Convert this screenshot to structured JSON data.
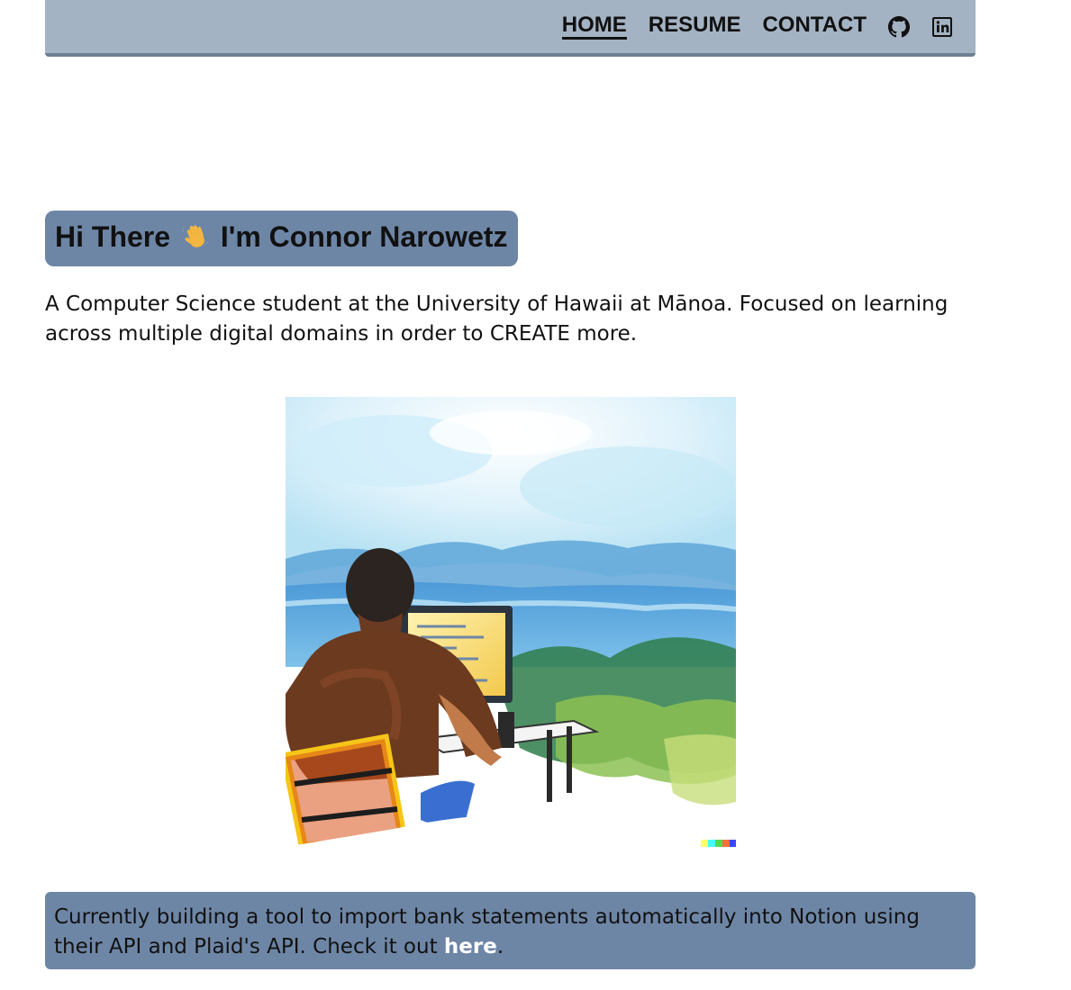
{
  "navbar": {
    "links": [
      {
        "label": "HOME",
        "active": true
      },
      {
        "label": "RESUME",
        "active": false
      },
      {
        "label": "CONTACT",
        "active": false
      }
    ],
    "icons": [
      "github-icon",
      "linkedin-icon"
    ],
    "background": "#a4b3c3",
    "border_color": "#6c7f94"
  },
  "hero": {
    "greeting": "Hi There",
    "emoji": "wave-emoji",
    "name_text": "I'm Connor Narowetz",
    "background": "#6e86a6"
  },
  "intro": {
    "text": "A Computer Science student at the University of Hawaii at Mānoa. Focused on learning across multiple digital domains in order to CREATE more."
  },
  "image": {
    "alt": "watercolor-person-coding-at-desk-overlooking-ocean"
  },
  "banner": {
    "text_before": "Currently building a tool to import bank statements automatically into Notion using their API and Plaid's API. Check it out ",
    "link_label": "here",
    "text_after": ".",
    "background": "#6e86a6",
    "link_color": "#ffffff"
  }
}
